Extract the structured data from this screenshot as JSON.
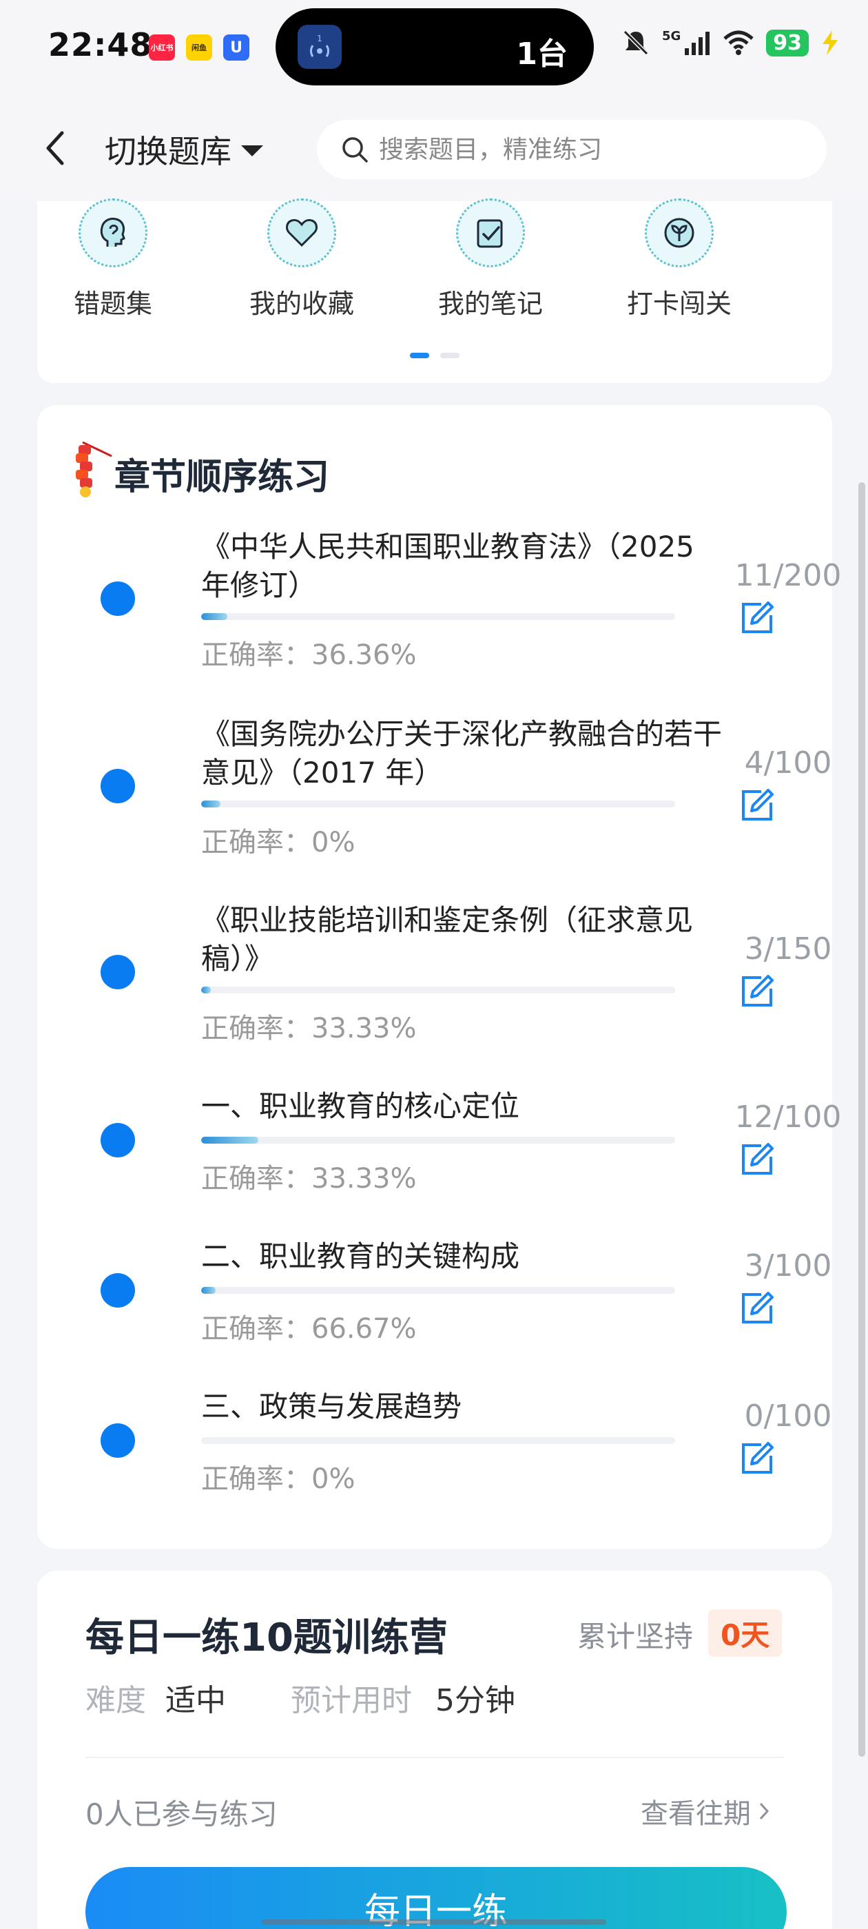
{
  "status_bar": {
    "time": "22:48",
    "apps": [
      "小红书",
      "闲鱼",
      "U"
    ],
    "island_text": "1台",
    "island_badge": "1",
    "network": "5G",
    "battery": "93"
  },
  "header": {
    "bank_switch_label": "切换题库",
    "search_placeholder": "搜索题目，精准练习"
  },
  "quick_tools": {
    "items": [
      {
        "label": "错题集",
        "icon": "head-icon"
      },
      {
        "label": "我的收藏",
        "icon": "heart-icon"
      },
      {
        "label": "我的笔记",
        "icon": "note-check-icon"
      },
      {
        "label": "打卡闯关",
        "icon": "sprout-icon"
      }
    ],
    "pages": 2,
    "active_page": 1
  },
  "chapters": {
    "title": "章节顺序练习",
    "items": [
      {
        "title": "《中华人民共和国职业教育法》（2025 年修订）",
        "count": "11/200",
        "accuracy": "正确率：36.36%",
        "progress": 0.055
      },
      {
        "title": "《国务院办公厅关于深化产教融合的若干意见》（2017 年）",
        "count": "4/100",
        "accuracy": "正确率：0%",
        "progress": 0.04
      },
      {
        "title": "《职业技能培训和鉴定条例（征求意见稿）》",
        "count": "3/150",
        "accuracy": "正确率：33.33%",
        "progress": 0.02
      },
      {
        "title": "一、职业教育的核心定位",
        "count": "12/100",
        "accuracy": "正确率：33.33%",
        "progress": 0.12
      },
      {
        "title": "二、职业教育的关键构成",
        "count": "3/100",
        "accuracy": "正确率：66.67%",
        "progress": 0.03
      },
      {
        "title": "三、政策与发展趋势",
        "count": "0/100",
        "accuracy": "正确率：0%",
        "progress": 0.0
      }
    ]
  },
  "daily": {
    "title": "每日一练10题训练营",
    "streak_label": "累计坚持",
    "streak_value": "0天",
    "difficulty_key": "难度",
    "difficulty_value": "适中",
    "time_key": "预计用时",
    "time_value": "5分钟",
    "participants": "0人已参与练习",
    "history_link": "查看往期",
    "button_label": "每日一练"
  }
}
